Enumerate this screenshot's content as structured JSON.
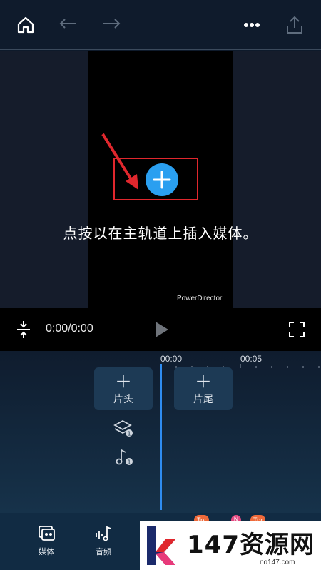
{
  "toolbar": {
    "home": "home-icon",
    "undo": "undo-icon",
    "redo": "redo-icon",
    "more": "more-icon",
    "export": "export-icon"
  },
  "preview": {
    "hint": "点按以在主轨道上插入媒体。",
    "watermark": "PowerDirector"
  },
  "playback": {
    "time": "0:00/0:00"
  },
  "timeline": {
    "ruler": [
      "00:00",
      "00:05"
    ],
    "intro_label": "片头",
    "outro_label": "片尾",
    "layer_badge": "1",
    "audio_badge": "1"
  },
  "bottom_nav": {
    "items": [
      {
        "label": "媒体",
        "icon": "media-icon"
      },
      {
        "label": "音频",
        "icon": "audio-icon"
      }
    ],
    "badges": [
      "Try",
      "N",
      "Try"
    ]
  },
  "site_watermark": {
    "name": "147资源网",
    "url": "no147.com"
  },
  "colors": {
    "accent": "#2a9ff0",
    "highlight_box": "#e0272d",
    "playhead": "#2f8cf0"
  }
}
